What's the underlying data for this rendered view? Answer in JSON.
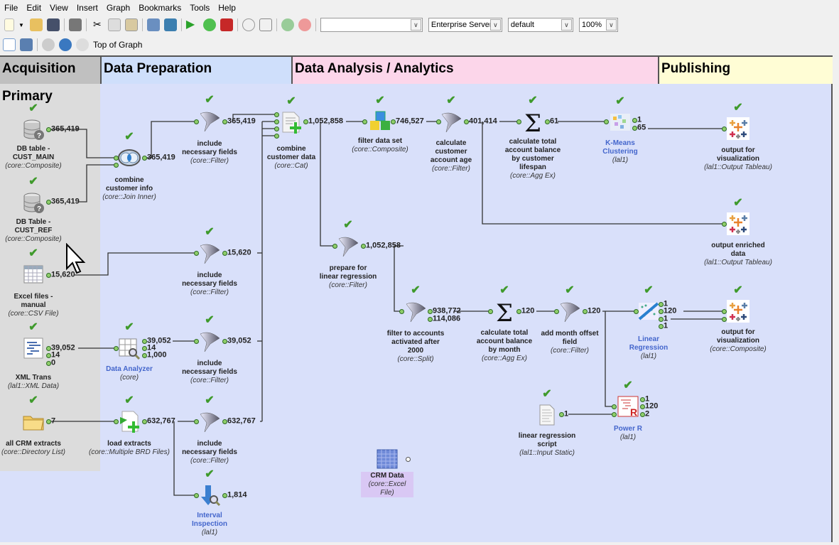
{
  "menu": [
    "File",
    "Edit",
    "View",
    "Insert",
    "Graph",
    "Bookmarks",
    "Tools",
    "Help"
  ],
  "toolbar": {
    "combo1": "",
    "server": "Enterprise Server",
    "profile": "default",
    "zoom": "100%"
  },
  "nav": {
    "location": "Top of Graph"
  },
  "lanes": {
    "acquisition": "Acquisition",
    "preparation": "Data Preparation",
    "analysis": "Data Analysis / Analytics",
    "publishing": "Publishing"
  },
  "primary_group": "Primary",
  "colors": {
    "acquisition": "#c0c0c0",
    "preparation": "#cfdffb",
    "analysis": "#fcd6ea",
    "publishing": "#fffdd5",
    "canvas": "#d9e0fa",
    "check": "#3f9a2c"
  },
  "nodes": {
    "db1": {
      "lines": [
        "DB table -",
        "CUST_MAIN"
      ],
      "type": "(core::Composite)",
      "outs": [
        "365,419"
      ],
      "icon": "database-icon"
    },
    "db2": {
      "lines": [
        "DB Table -",
        "CUST_REF"
      ],
      "type": "(core::Composite)",
      "outs": [
        "365,419"
      ],
      "icon": "database-icon"
    },
    "excel": {
      "lines": [
        "Excel files -",
        "manual"
      ],
      "type": "(core::CSV File)",
      "outs": [
        "15,620"
      ],
      "icon": "spreadsheet-icon"
    },
    "xml": {
      "lines": [
        "XML Trans"
      ],
      "type": "(lal1::XML Data)",
      "outs": [
        "39,052",
        "14",
        "0"
      ],
      "icon": "xml-icon"
    },
    "crm": {
      "lines": [
        "all CRM extracts"
      ],
      "type": "(core::Directory List)",
      "outs": [
        "7"
      ],
      "icon": "folder-icon"
    },
    "join": {
      "lines": [
        "combine",
        "customer info"
      ],
      "type": "(core::Join Inner)",
      "outs": [
        "365,419"
      ],
      "icon": "join-icon"
    },
    "f1": {
      "lines": [
        "include",
        "necessary fields"
      ],
      "type": "(core::Filter)",
      "outs": [
        "365,419"
      ],
      "icon": "funnel-icon"
    },
    "f2": {
      "lines": [
        "include",
        "necessary fields"
      ],
      "type": "(core::Filter)",
      "outs": [
        "15,620"
      ],
      "icon": "funnel-icon"
    },
    "analyzer": {
      "lines": [
        "Data Analyzer"
      ],
      "type": "(core)",
      "outs": [
        "39,052",
        "14",
        "1,000"
      ],
      "icon": "analyzer-icon"
    },
    "f3": {
      "lines": [
        "include",
        "necessary fields"
      ],
      "type": "(core::Filter)",
      "outs": [
        "39,052"
      ],
      "icon": "funnel-icon"
    },
    "load": {
      "lines": [
        "load extracts"
      ],
      "type": "(core::Multiple BRD Files)",
      "outs": [
        "632,767"
      ],
      "icon": "load-icon"
    },
    "f4": {
      "lines": [
        "include",
        "necessary fields"
      ],
      "type": "(core::Filter)",
      "outs": [
        "632,767"
      ],
      "icon": "funnel-icon"
    },
    "interval": {
      "lines": [
        "Interval",
        "Inspection"
      ],
      "type": "(lal1)",
      "outs": [
        "1,814"
      ],
      "icon": "interval-icon"
    },
    "cat": {
      "lines": [
        "combine",
        "customer data"
      ],
      "type": "(core::Cat)",
      "outs": [
        "1,052,858"
      ],
      "icon": "doc-plus-icon"
    },
    "fds": {
      "lines": [
        "filter data set"
      ],
      "type": "(core::Composite)",
      "outs": [
        "746,527"
      ],
      "icon": "cubes-icon"
    },
    "age": {
      "lines": [
        "calculate",
        "customer",
        "account age"
      ],
      "type": "(core::Filter)",
      "outs": [
        "401,414"
      ],
      "icon": "funnel-icon"
    },
    "sum1": {
      "lines": [
        "calculate total",
        "account balance",
        "by customer",
        "lifespan"
      ],
      "type": "(core::Agg Ex)",
      "outs": [
        "61"
      ],
      "icon": "sigma-icon"
    },
    "kmeans": {
      "lines": [
        "K-Means",
        "Clustering"
      ],
      "type": "(lal1)",
      "outs": [
        "1",
        "65"
      ],
      "icon": "kmeans-icon"
    },
    "out1": {
      "lines": [
        "output for",
        "visualization"
      ],
      "type": "(lal1::Output Tableau)",
      "outs": [],
      "icon": "tableau-icon"
    },
    "out2": {
      "lines": [
        "output enriched",
        "data"
      ],
      "type": "(lal1::Output Tableau)",
      "outs": [],
      "icon": "tableau-icon"
    },
    "prep": {
      "lines": [
        "prepare for",
        "linear regression"
      ],
      "type": "(core::Filter)",
      "outs": [
        "1,052,858"
      ],
      "icon": "funnel-icon"
    },
    "split": {
      "lines": [
        "filter to accounts",
        "activated after",
        "2000"
      ],
      "type": "(core::Split)",
      "outs": [
        "938,772",
        "114,086"
      ],
      "icon": "funnel-icon"
    },
    "sum2": {
      "lines": [
        "calculate total",
        "account balance",
        "by month"
      ],
      "type": "(core::Agg Ex)",
      "outs": [
        "120"
      ],
      "icon": "sigma-icon"
    },
    "offset": {
      "lines": [
        "add month offset",
        "field"
      ],
      "type": "(core::Filter)",
      "outs": [
        "120"
      ],
      "icon": "funnel-icon"
    },
    "linreg": {
      "lines": [
        "Linear",
        "Regression"
      ],
      "type": "(lal1)",
      "outs": [
        "1",
        "120",
        "1",
        "1"
      ],
      "icon": "regression-icon"
    },
    "out3": {
      "lines": [
        "output for",
        "visualization"
      ],
      "type": "(core::Composite)",
      "outs": [],
      "icon": "tableau-icon"
    },
    "script": {
      "lines": [
        "linear regression",
        "script"
      ],
      "type": "(lal1::Input Static)",
      "outs": [
        "1"
      ],
      "icon": "script-icon"
    },
    "powerr": {
      "lines": [
        "Power R"
      ],
      "type": "(lal1)",
      "outs": [
        "1",
        "120",
        "2"
      ],
      "icon": "power-r-icon"
    },
    "crmdata": {
      "lines": [
        "CRM Data"
      ],
      "type": "(core::Excel File)",
      "outs": [],
      "icon": "excel-grid-icon"
    }
  }
}
